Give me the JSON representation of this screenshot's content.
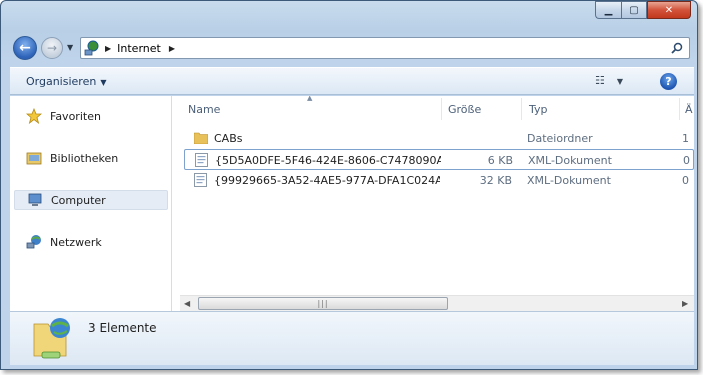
{
  "address": {
    "crumbs": [
      "Internet"
    ]
  },
  "toolbar": {
    "organize_label": "Organisieren"
  },
  "nav": {
    "items": [
      {
        "label": "Favoriten",
        "icon": "star-icon"
      },
      {
        "label": "Bibliotheken",
        "icon": "library-icon"
      },
      {
        "label": "Computer",
        "icon": "computer-icon",
        "selected": true
      },
      {
        "label": "Netzwerk",
        "icon": "network-icon"
      }
    ]
  },
  "columns": {
    "name": "Name",
    "size": "Größe",
    "type": "Typ",
    "extra": "Ä"
  },
  "files": [
    {
      "name": "CABs",
      "size": "",
      "type": "Dateiordner",
      "extra": "1",
      "icon": "folder-icon"
    },
    {
      "name": "{5D5A0DFE-5F46-424E-8606-C7478090A1...",
      "size": "6 KB",
      "type": "XML-Dokument",
      "extra": "0",
      "icon": "xml-file-icon"
    },
    {
      "name": "{99929665-3A52-4AE5-977A-DFA1C024A...",
      "size": "32 KB",
      "type": "XML-Dokument",
      "extra": "0",
      "icon": "xml-file-icon"
    }
  ],
  "details": {
    "count_text": "3 Elemente"
  }
}
